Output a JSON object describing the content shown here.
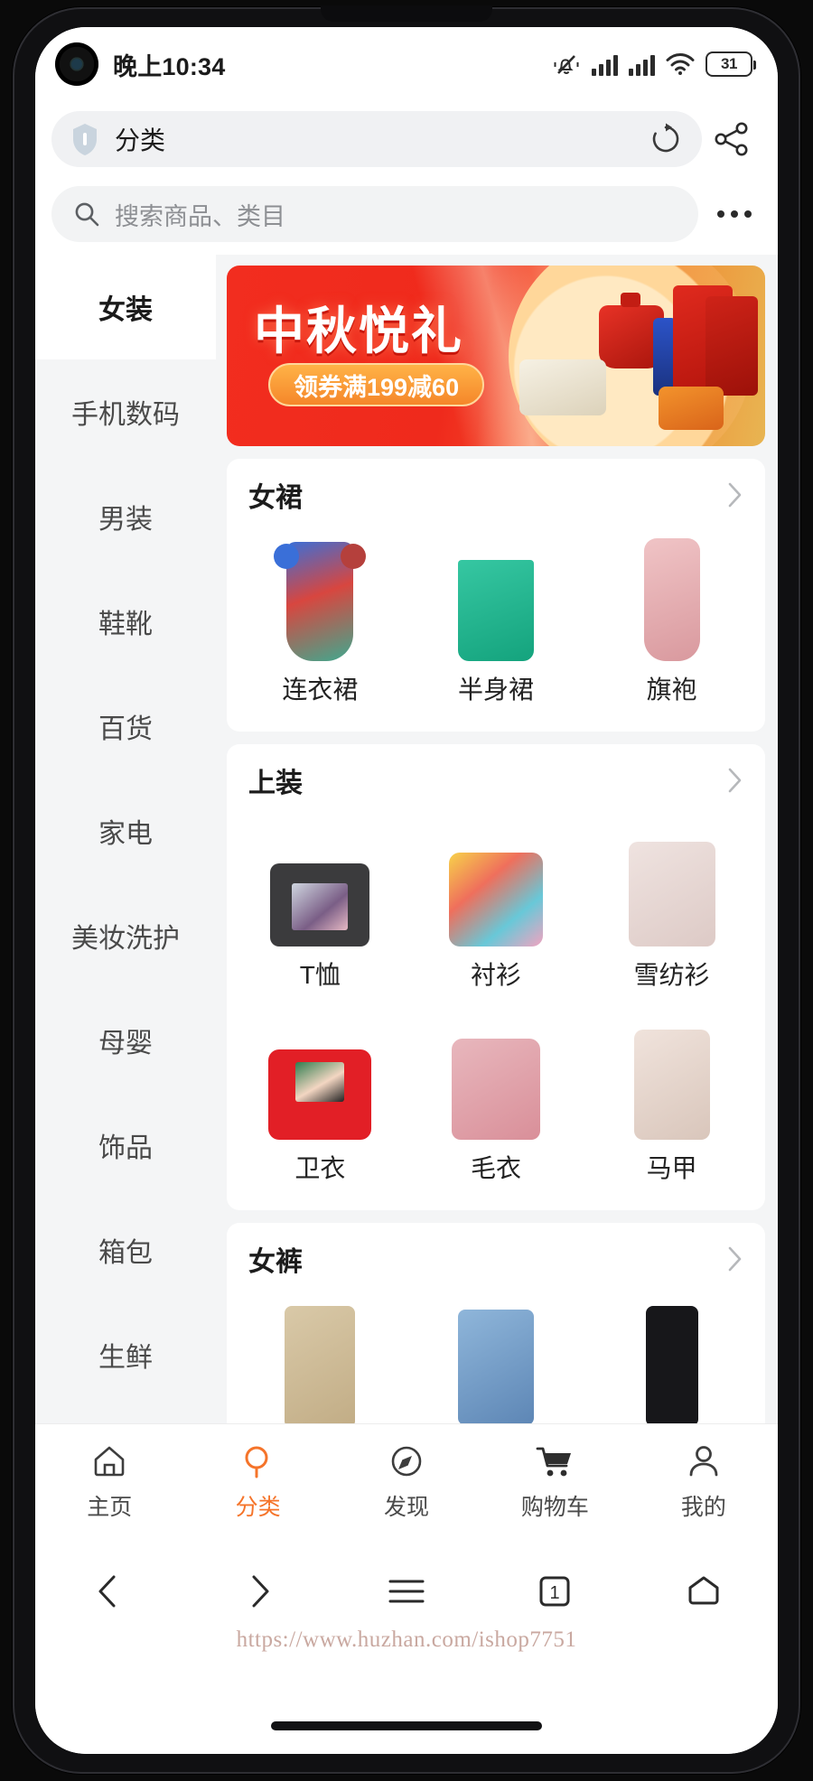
{
  "status_bar": {
    "time": "晚上10:34",
    "icons": [
      "mute-icon",
      "signal-icon",
      "signal-icon-2",
      "wifi-icon"
    ],
    "battery_level": "31"
  },
  "browser": {
    "shield_icon": "shield-icon",
    "page_title": "分类",
    "reload_icon": "reload-icon",
    "share_icon": "share-icon"
  },
  "search": {
    "icon": "search-icon",
    "placeholder": "搜索商品、类目",
    "more_icon": "more-dots-icon"
  },
  "sidebar": {
    "items": [
      {
        "label": "女装",
        "active": true
      },
      {
        "label": "手机数码",
        "active": false
      },
      {
        "label": "男装",
        "active": false
      },
      {
        "label": "鞋靴",
        "active": false
      },
      {
        "label": "百货",
        "active": false
      },
      {
        "label": "家电",
        "active": false
      },
      {
        "label": "美妆洗护",
        "active": false
      },
      {
        "label": "母婴",
        "active": false
      },
      {
        "label": "饰品",
        "active": false
      },
      {
        "label": "箱包",
        "active": false
      },
      {
        "label": "生鲜",
        "active": false
      }
    ]
  },
  "banner": {
    "title": "中秋悦礼",
    "coupon": "领券满199减60",
    "accent_color": "#f22d1f",
    "coupon_color": "#f5872a"
  },
  "sections": [
    {
      "title": "女裙",
      "arrow_icon": "chevron-right-icon",
      "items": [
        {
          "label": "连衣裙",
          "shape": "g-dress"
        },
        {
          "label": "半身裙",
          "shape": "g-skirt"
        },
        {
          "label": "旗袍",
          "shape": "g-qipao"
        }
      ]
    },
    {
      "title": "上装",
      "arrow_icon": "chevron-right-icon",
      "items": [
        {
          "label": "T恤",
          "shape": "g-tee"
        },
        {
          "label": "衬衫",
          "shape": "g-shirt"
        },
        {
          "label": "雪纺衫",
          "shape": "g-chiffon"
        },
        {
          "label": "卫衣",
          "shape": "g-hoodie"
        },
        {
          "label": "毛衣",
          "shape": "g-sweater"
        },
        {
          "label": "马甲",
          "shape": "g-vest"
        }
      ]
    },
    {
      "title": "女裤",
      "arrow_icon": "chevron-right-icon",
      "items": [
        {
          "label": "",
          "shape": "g-pants"
        },
        {
          "label": "",
          "shape": "g-jeans"
        },
        {
          "label": "",
          "shape": "g-legging"
        }
      ]
    }
  ],
  "tabbar": {
    "items": [
      {
        "label": "主页",
        "icon": "home-icon",
        "active": false
      },
      {
        "label": "分类",
        "icon": "search-category-icon",
        "active": true
      },
      {
        "label": "发现",
        "icon": "compass-icon",
        "active": false
      },
      {
        "label": "购物车",
        "icon": "cart-icon",
        "active": false
      },
      {
        "label": "我的",
        "icon": "person-icon",
        "active": false
      }
    ],
    "active_color": "#f5742a"
  },
  "android_nav": {
    "items": [
      "back-icon",
      "forward-icon",
      "menu-icon",
      "tabs-count-icon",
      "home-pentagon-icon"
    ],
    "tabs_count": "1"
  },
  "watermark": "https://www.huzhan.com/ishop7751"
}
